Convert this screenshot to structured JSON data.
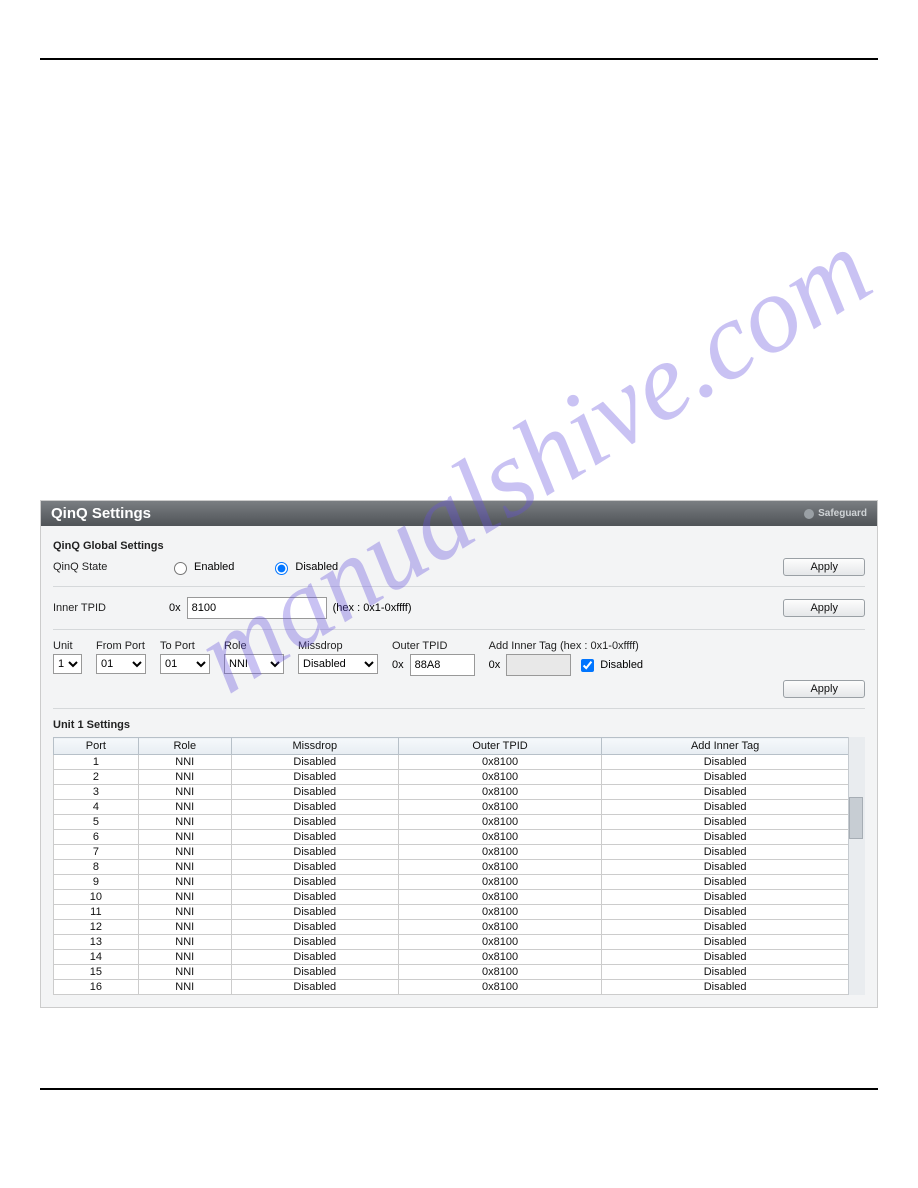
{
  "watermark": "manualshive.com",
  "panel": {
    "title": "QinQ Settings",
    "safeguard": "Safeguard"
  },
  "global": {
    "heading": "QinQ Global Settings",
    "state_label": "QinQ State",
    "enabled_label": "Enabled",
    "disabled_label": "Disabled",
    "apply": "Apply"
  },
  "inner_tpid": {
    "label": "Inner TPID",
    "prefix": "0x",
    "value": "8100",
    "hint": "(hex : 0x1-0xffff)",
    "apply": "Apply"
  },
  "port_config": {
    "unit_label": "Unit",
    "from_port_label": "From Port",
    "to_port_label": "To Port",
    "role_label": "Role",
    "missdrop_label": "Missdrop",
    "outer_tpid_label": "Outer TPID",
    "add_inner_tag_label": "Add Inner Tag (hex : 0x1-0xffff)",
    "unit": "1",
    "from_port": "01",
    "to_port": "01",
    "role": "NNI",
    "missdrop": "Disabled",
    "outer_prefix": "0x",
    "outer_value": "88A8",
    "inner_prefix": "0x",
    "disabled_cb": "Disabled",
    "apply": "Apply"
  },
  "unit_settings": {
    "heading": "Unit 1 Settings",
    "headers": {
      "port": "Port",
      "role": "Role",
      "missdrop": "Missdrop",
      "outer_tpid": "Outer TPID",
      "add_inner_tag": "Add Inner Tag"
    },
    "rows": [
      {
        "port": "1",
        "role": "NNI",
        "missdrop": "Disabled",
        "outer": "0x8100",
        "inner": "Disabled"
      },
      {
        "port": "2",
        "role": "NNI",
        "missdrop": "Disabled",
        "outer": "0x8100",
        "inner": "Disabled"
      },
      {
        "port": "3",
        "role": "NNI",
        "missdrop": "Disabled",
        "outer": "0x8100",
        "inner": "Disabled"
      },
      {
        "port": "4",
        "role": "NNI",
        "missdrop": "Disabled",
        "outer": "0x8100",
        "inner": "Disabled"
      },
      {
        "port": "5",
        "role": "NNI",
        "missdrop": "Disabled",
        "outer": "0x8100",
        "inner": "Disabled"
      },
      {
        "port": "6",
        "role": "NNI",
        "missdrop": "Disabled",
        "outer": "0x8100",
        "inner": "Disabled"
      },
      {
        "port": "7",
        "role": "NNI",
        "missdrop": "Disabled",
        "outer": "0x8100",
        "inner": "Disabled"
      },
      {
        "port": "8",
        "role": "NNI",
        "missdrop": "Disabled",
        "outer": "0x8100",
        "inner": "Disabled"
      },
      {
        "port": "9",
        "role": "NNI",
        "missdrop": "Disabled",
        "outer": "0x8100",
        "inner": "Disabled"
      },
      {
        "port": "10",
        "role": "NNI",
        "missdrop": "Disabled",
        "outer": "0x8100",
        "inner": "Disabled"
      },
      {
        "port": "11",
        "role": "NNI",
        "missdrop": "Disabled",
        "outer": "0x8100",
        "inner": "Disabled"
      },
      {
        "port": "12",
        "role": "NNI",
        "missdrop": "Disabled",
        "outer": "0x8100",
        "inner": "Disabled"
      },
      {
        "port": "13",
        "role": "NNI",
        "missdrop": "Disabled",
        "outer": "0x8100",
        "inner": "Disabled"
      },
      {
        "port": "14",
        "role": "NNI",
        "missdrop": "Disabled",
        "outer": "0x8100",
        "inner": "Disabled"
      },
      {
        "port": "15",
        "role": "NNI",
        "missdrop": "Disabled",
        "outer": "0x8100",
        "inner": "Disabled"
      },
      {
        "port": "16",
        "role": "NNI",
        "missdrop": "Disabled",
        "outer": "0x8100",
        "inner": "Disabled"
      }
    ]
  }
}
